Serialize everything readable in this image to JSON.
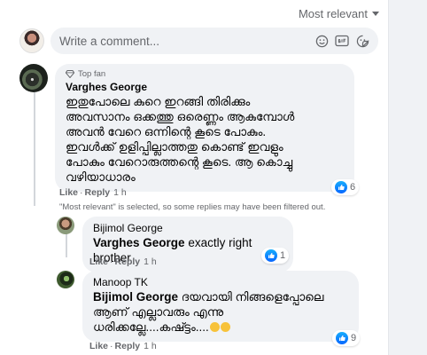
{
  "header": {
    "sort_label": "Most relevant"
  },
  "composer": {
    "placeholder": "Write a comment...",
    "icons": [
      "emoji-icon",
      "gif-icon",
      "sticker-icon"
    ]
  },
  "comments": [
    {
      "badge": "Top fan",
      "author": "Varghes George",
      "lines": [
        "ഇതുപോലെ കുറെ ഇറങ്ങി തിരിക്കും",
        "അവസാനം ഒക്കത്തു ഒരെണ്ണം ആകുമ്പോൾ",
        "അവൻ വേറെ ഒന്നിന്റെ കൂടെ പോകും.",
        "ഇവൾക്ക് ഉളിപ്പില്ലാത്തതു കൊണ്ട് ഇവളും",
        "പോകും വേറൊരുത്തന്റെ കൂടെ. ആ കൊച്ചു",
        "വഴിയാധാരം"
      ],
      "like_label": "Like",
      "reply_label": "Reply",
      "time": "1 h",
      "reaction_count": "6"
    }
  ],
  "filter_note": "\"Most relevant\" is selected, so some replies may have been filtered out.",
  "replies": [
    {
      "author": "Bijimol George",
      "mention": "Varghes George",
      "text": "exactly right brother",
      "like_label": "Like",
      "reply_label": "Reply",
      "time": "1 h",
      "reaction_count": "1"
    },
    {
      "author": "Manoop TK",
      "mention": "Bijimol George",
      "text_first": "ദയവായി നിങ്ങളെപ്പോലെ",
      "lines": [
        "ആണ് എല്ലാവരും എന്നു",
        "ധരിക്കല്ലേ....കഷ്ട്ടം...."
      ],
      "like_label": "Like",
      "reply_label": "Reply",
      "time": "1 h",
      "reaction_count": "9"
    }
  ]
}
